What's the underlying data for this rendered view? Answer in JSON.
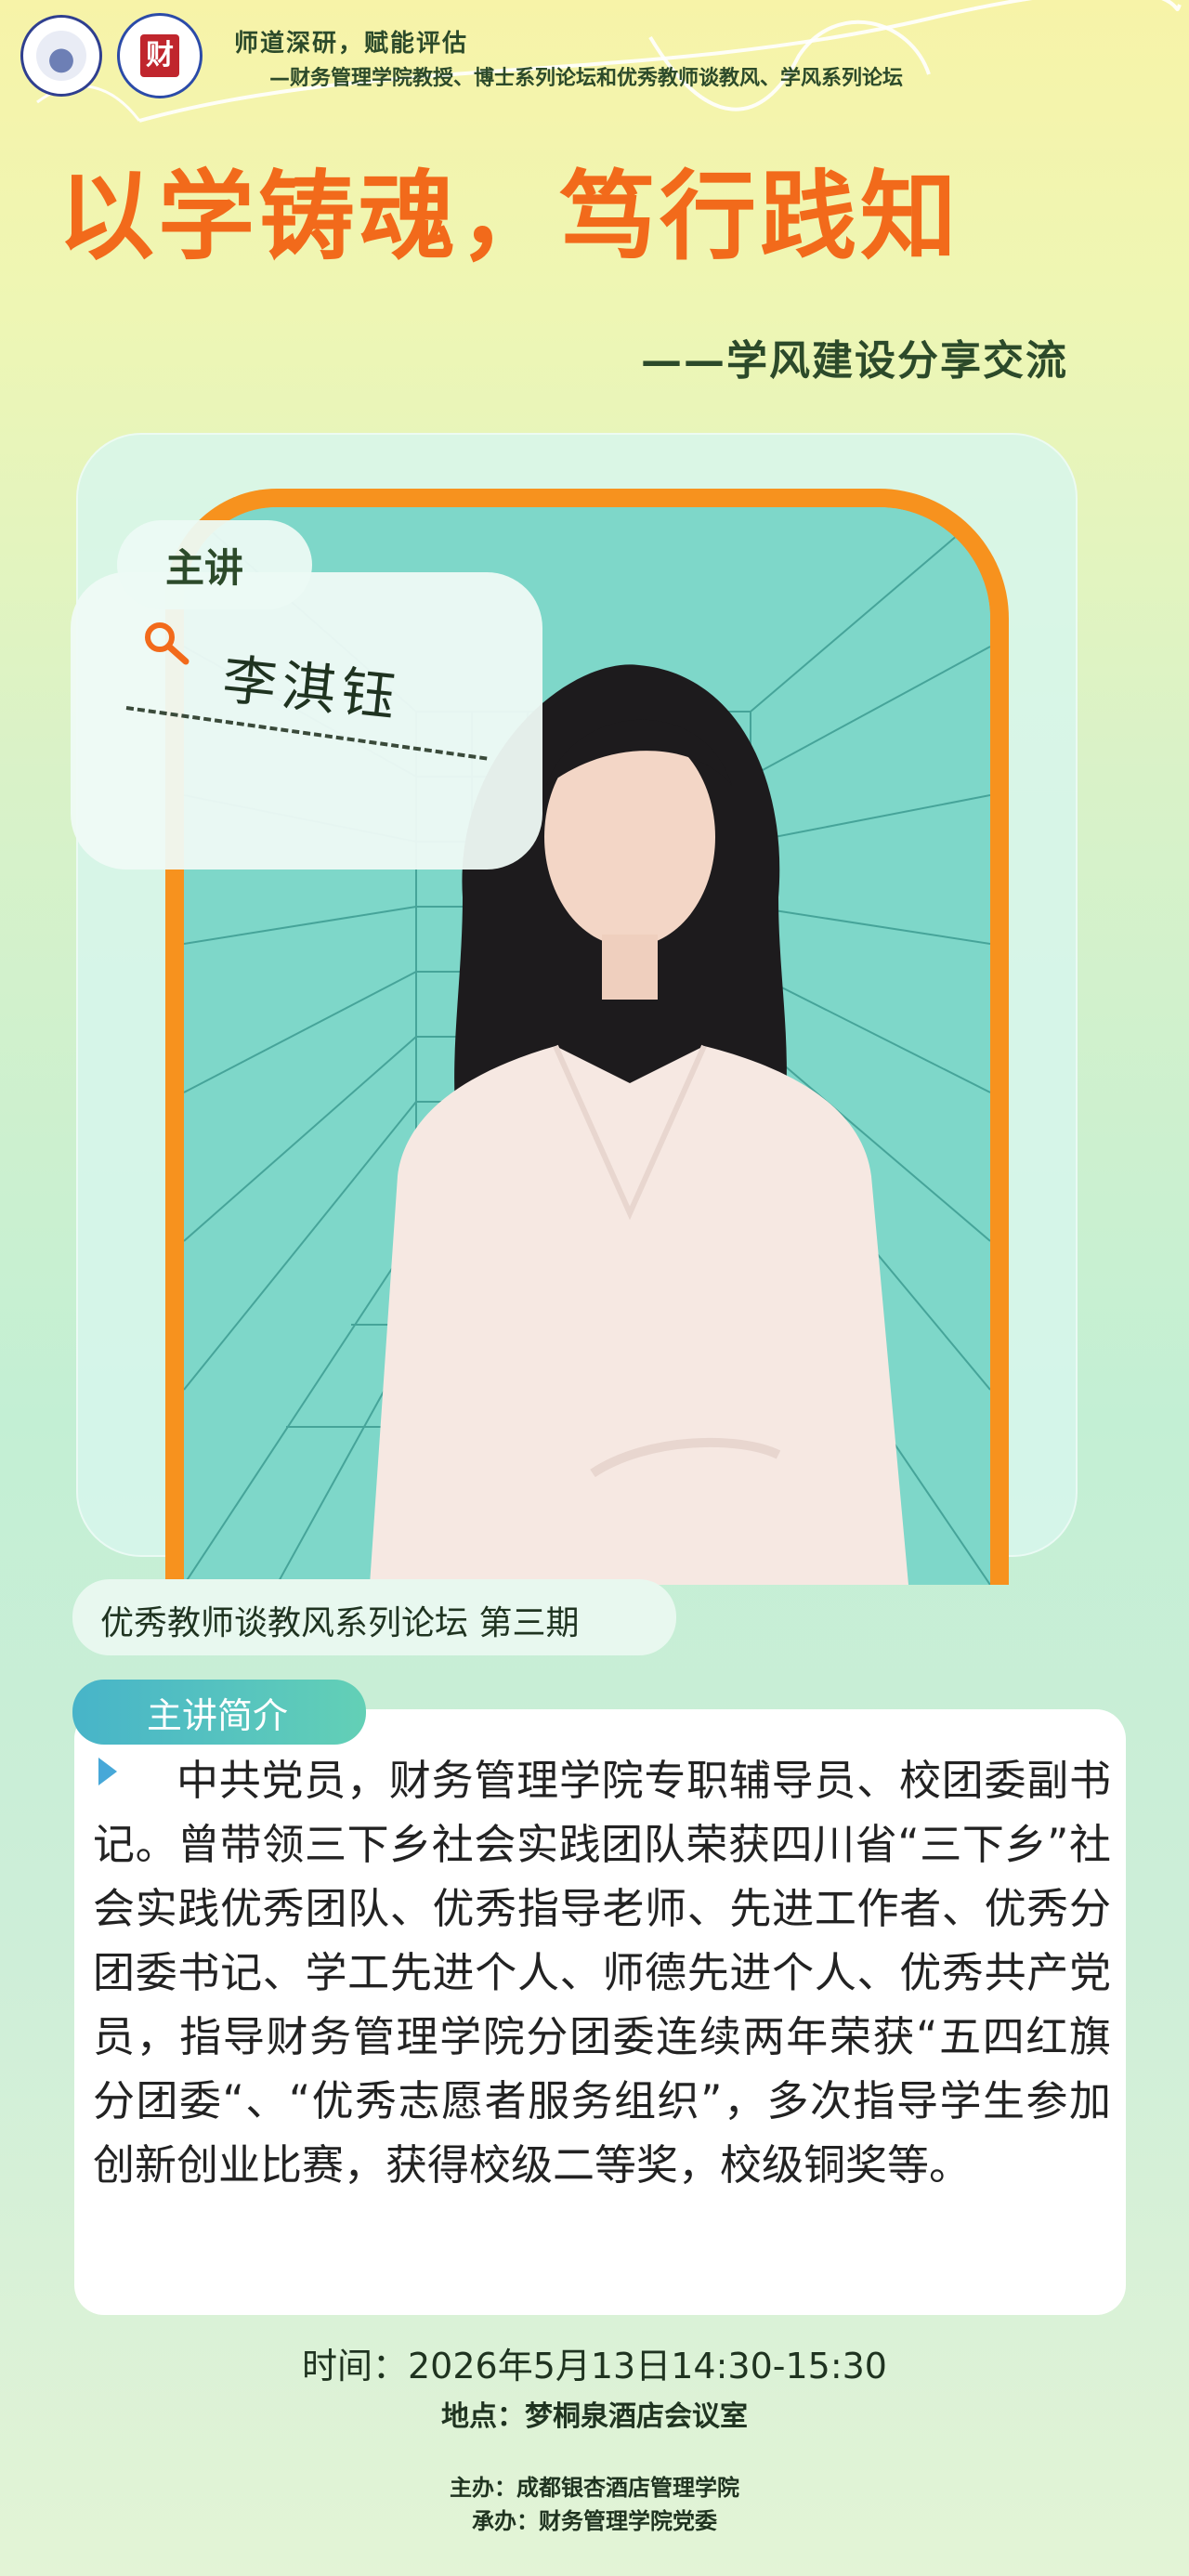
{
  "header": {
    "slogan": "师道深研，赋能评估",
    "subline": "—财务管理学院教授、博士系列论坛和优秀教师谈教风、学风系列论坛",
    "logo2_char": "财"
  },
  "title": "以学铸魂，笃行践知",
  "subtitle": "——学风建设分享交流",
  "speaker": {
    "tag": "主讲",
    "name": "李淇钰"
  },
  "series": "优秀教师谈教风系列论坛 第三期",
  "intro": {
    "label": "主讲简介",
    "text": "中共党员，财务管理学院专职辅导员、校团委副书记。曾带领三下乡社会实践团队荣获四川省“三下乡”社会实践优秀团队、优秀指导老师、先进工作者、优秀分团委书记、学工先进个人、师德先进个人、优秀共产党员，指导财务管理学院分团委连续两年荣获“五四红旗分团委“、“优秀志愿者服务组织”，多次指导学生参加创新创业比赛，获得校级二等奖，校级铜奖等。"
  },
  "event": {
    "time": "时间：2026年5月13日14:30-15:30",
    "place": "地点：梦桐泉酒店会议室",
    "host": "主办：成都银杏酒店管理学院",
    "undertake": "承办：财务管理学院党委"
  },
  "colors": {
    "title": "#f26a1b",
    "frame": "#f7921e",
    "grid_bg": "#7ed7c9",
    "accent": "#47b4c9"
  }
}
